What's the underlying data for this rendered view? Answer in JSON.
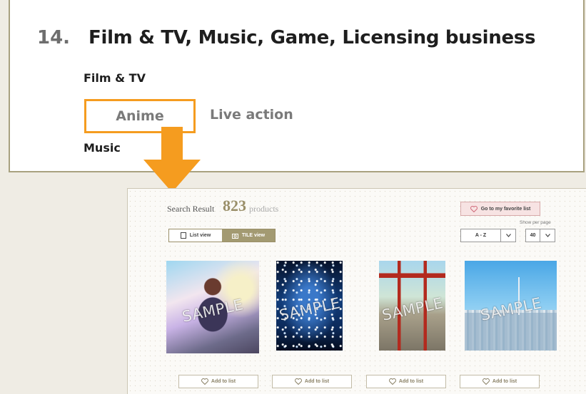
{
  "heading": {
    "number": "14.",
    "title": "Film & TV, Music, Game, Licensing business"
  },
  "categories": {
    "film_tv": "Film & TV",
    "anime_tab": "Anime",
    "live_action_tab": "Live action",
    "music": "Music"
  },
  "colors": {
    "highlight_orange": "#f59c1f",
    "accent_gold": "#9a8f69",
    "favorite_pink": "#f7e3e3"
  },
  "search": {
    "label": "Search Result",
    "count": "823",
    "unit": "products",
    "favorite_button": "Go to my favorite list",
    "list_view": "List view",
    "tile_view": "TILE view",
    "show_per_page_label": "Show per page",
    "sort_value": "A - Z",
    "per_page_value": "40"
  },
  "products": [
    {
      "watermark": "SAMPLE",
      "add_label": "Add to list"
    },
    {
      "watermark": "SAMPLE",
      "add_label": "Add to list"
    },
    {
      "watermark": "SAMPLE",
      "add_label": "Add to list"
    },
    {
      "watermark": "SAMPLE",
      "add_label": "Add to list"
    }
  ]
}
